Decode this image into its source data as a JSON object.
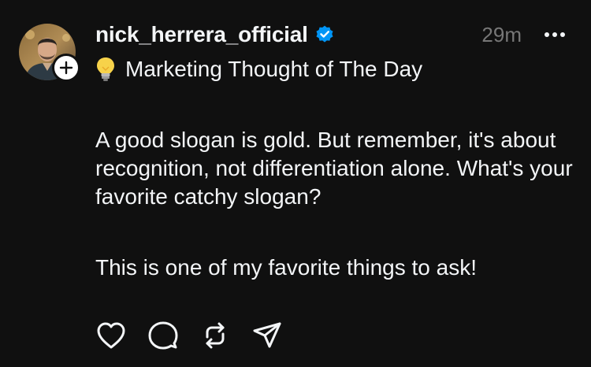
{
  "post": {
    "author": {
      "username": "nick_herrera_official",
      "verified": true,
      "avatar_icon": "profile-photo",
      "follow_icon": "plus-icon"
    },
    "timestamp": "29m",
    "more_icon": "more-horizontal-icon",
    "headline_emoji_icon": "lightbulb-icon",
    "headline": "Marketing Thought of The Day",
    "paragraphs": [
      "A good slogan is gold. But remember, it's about recognition, not differentiation alone. What's your favorite catchy slogan?",
      "This is one of my favorite things to ask!"
    ],
    "actions": [
      {
        "icon": "heart-icon",
        "label": "Like"
      },
      {
        "icon": "comment-icon",
        "label": "Reply"
      },
      {
        "icon": "repost-icon",
        "label": "Repost"
      },
      {
        "icon": "share-icon",
        "label": "Share"
      }
    ]
  },
  "colors": {
    "background": "#101010",
    "text": "#f3f5f7",
    "muted": "#777777",
    "verified_badge": "#0095f6"
  }
}
